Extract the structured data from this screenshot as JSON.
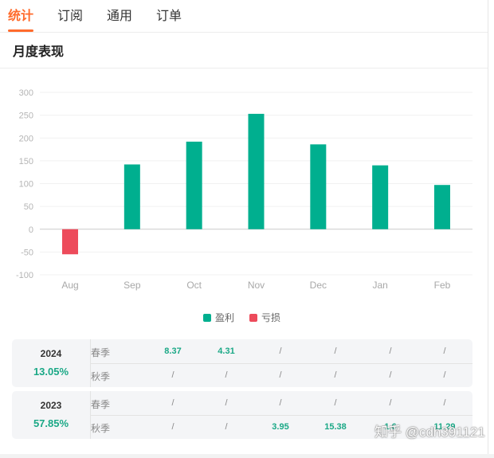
{
  "tabs": [
    {
      "label": "统计",
      "active": true
    },
    {
      "label": "订阅",
      "active": false
    },
    {
      "label": "通用",
      "active": false
    },
    {
      "label": "订单",
      "active": false
    }
  ],
  "section": {
    "title": "月度表现"
  },
  "colors": {
    "accent": "#ff6b2c",
    "profit": "#00af8f",
    "loss": "#ed4b5b",
    "percent_text": "#1aa886"
  },
  "chart_data": {
    "type": "bar",
    "categories": [
      "Aug",
      "Sep",
      "Oct",
      "Nov",
      "Dec",
      "Jan",
      "Feb"
    ],
    "values": [
      -55,
      142,
      192,
      253,
      186,
      140,
      97
    ],
    "ylim": [
      -100,
      300
    ],
    "yticks": [
      300,
      250,
      200,
      150,
      100,
      50,
      0,
      -50,
      -100
    ],
    "grid": true,
    "legend_position": "bottom-center",
    "legend": [
      {
        "label": "盈利",
        "color": "#00af8f"
      },
      {
        "label": "亏损",
        "color": "#ed4b5b"
      }
    ]
  },
  "years": [
    {
      "year": "2024",
      "percent": "13.05%",
      "rows": [
        {
          "season": "春季",
          "cells": [
            "8.37",
            "4.31",
            "/",
            "/",
            "/",
            "/"
          ]
        },
        {
          "season": "秋季",
          "cells": [
            "/",
            "/",
            "/",
            "/",
            "/",
            "/"
          ]
        }
      ]
    },
    {
      "year": "2023",
      "percent": "57.85%",
      "rows": [
        {
          "season": "春季",
          "cells": [
            "/",
            "/",
            "/",
            "/",
            "/",
            "/"
          ]
        },
        {
          "season": "秋季",
          "cells": [
            "/",
            "/",
            "3.95",
            "15.38",
            "1.6",
            "11.29"
          ]
        }
      ]
    }
  ],
  "watermark": "知乎 @cdh391121"
}
